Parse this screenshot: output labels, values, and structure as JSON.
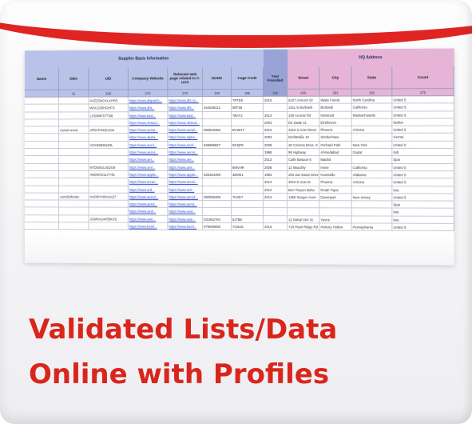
{
  "caption": {
    "line1": "Validated Lists/Data",
    "line2": "Online with Profiles"
  },
  "colors": {
    "accent": "#e02424",
    "caption": "#d9261c",
    "supplier_header": "#b9c3ea",
    "year_header": "#9aa3d8",
    "hq_header": "#e6b4d6"
  },
  "sheet": {
    "groups": {
      "supplier": "Supplier Basic Information",
      "hq": "HQ Address"
    },
    "columns": [
      {
        "label": "Name",
        "num": ""
      },
      {
        "label": "DBA",
        "num": "21"
      },
      {
        "label": "UEI",
        "num": "209"
      },
      {
        "label": "Company Website",
        "num": "270"
      },
      {
        "label": "Relevant web page related to C-UAS",
        "num": "270"
      },
      {
        "label": "DUNS",
        "num": "126"
      },
      {
        "label": "Cage Code",
        "num": "196"
      },
      {
        "label": "Year Founded",
        "num": "160"
      },
      {
        "label": "Street",
        "num": "255"
      },
      {
        "label": "City",
        "num": "253"
      },
      {
        "label": "State",
        "num": "192"
      },
      {
        "label": "Count",
        "num": "275"
      }
    ],
    "rows": [
      [
        "",
        "",
        "K4ZZSNCKLKHR3",
        "https://www.dispatch...",
        "https://www.dht.co...",
        "",
        "7RTE8",
        "2016",
        "6107 Unicorn Dr",
        "Wake Forest",
        "North Carolina",
        "United S"
      ],
      [
        "",
        "",
        "WULSZ8HGHFS",
        "https://www.dht...",
        "https://www.dht...",
        "044536414",
        "58TS6",
        "",
        "1911 N Burbank",
        "Burbank",
        "California",
        "United S"
      ],
      [
        "",
        "",
        "LSS9MFS7TN8",
        "https://www.kast...",
        "https://www.kast...",
        "",
        "7BAY2",
        "2014",
        "106 Access Rd",
        "Norwood",
        "Massachusetts",
        "United S"
      ],
      [
        "",
        "",
        "",
        "https://www.40stud...",
        "https://www.40stud...",
        "",
        "",
        "2003",
        "De Zaale 11",
        "Eindhoven",
        "",
        "Nether"
      ],
      [
        "",
        "Aerial Armor",
        "JPDVFN4ZLD34",
        "https://www.aerial...",
        "https://www.aerial...",
        "080533486",
        "8CWUT",
        "2016",
        "4310 S 21st Street",
        "Phoenix",
        "Arizona",
        "United S"
      ],
      [
        "",
        "",
        "",
        "https://www.alpha...",
        "https://www.alpha...",
        "",
        "",
        "2003",
        "Dorfstraße 10",
        "Simbuchsee",
        "",
        "Germa"
      ],
      [
        "",
        "",
        "VCK8SE6N1RL",
        "https://www.ancil...",
        "https://www.ancil...",
        "828986927",
        "9GQF8",
        "2008",
        "40 Corinna Drive, S",
        "Orchard Park",
        "New York",
        "United S"
      ],
      [
        "",
        "",
        "",
        "https://www.aeros...",
        "https://www.aeros...",
        "",
        "",
        "1988",
        "96 Highway",
        "Ahmedabad",
        "Gujrat",
        "Indi"
      ],
      [
        "",
        "",
        "",
        "https://www.aer...",
        "https://www.aer...",
        "",
        "",
        "2013",
        "Calle Basauri 6",
        "Madrid",
        "",
        "Spai"
      ],
      [
        "",
        "",
        "NTDS6GL4S2G9",
        "https://www.aml...",
        "https://www.aml...",
        "",
        "8MVHR",
        "2008",
        "12 Mauchly",
        "Irvine",
        "California",
        "United S"
      ],
      [
        "",
        "",
        "H6SNHG1LF745",
        "https://www.applie...",
        "https://www.applie...",
        "625464499",
        "3EMK1",
        "1983",
        "403 Jan Davis Drive",
        "Huntsville",
        "Alabama",
        "United S"
      ],
      [
        "",
        "",
        "",
        "https://www.arcan...",
        "https://www.arcan...",
        "",
        "",
        "2014",
        "4010 E 21st St",
        "Phoenix",
        "Arizona",
        "United S"
      ],
      [
        "",
        "",
        "",
        "https://www.ard...",
        "https://www.ard...",
        "",
        "",
        "2012",
        "Ben Tsvyon Bahu",
        "Petah Tiqva",
        "",
        "Isra"
      ],
      [
        "",
        "AeroDefense",
        "HAPBYHNH4AZ7",
        "https://www.aerod...",
        "https://www.aerod...",
        "080059489",
        "7HXE7",
        "2013",
        "1350 Sanger Aven",
        "Davenport",
        "New Jersey",
        "United S"
      ],
      [
        "",
        "",
        "",
        "https://www.aerot...",
        "https://www.aerot...",
        "",
        "",
        "",
        "",
        "",
        "",
        "Spai"
      ],
      [
        "",
        "",
        "",
        "https://www.aval...",
        "https://www.aval...",
        "",
        "",
        "",
        "",
        "",
        "",
        "Isra"
      ],
      [
        "",
        "",
        "JCMHAUKPBKVS",
        "https://www.avie...",
        "https://www.avie...",
        "031862784",
        "5J7B6",
        "",
        "12 Nahal Sinr St",
        "Yavne",
        "",
        "Isra"
      ],
      [
        "",
        "",
        "",
        "https://www.baml...",
        "https://www.baml...",
        "079058685",
        "7CDU5",
        "2016",
        "710 Pearl Ridge Rd",
        "Hickory Hollow",
        "Pennsylvania",
        "United S"
      ]
    ]
  }
}
